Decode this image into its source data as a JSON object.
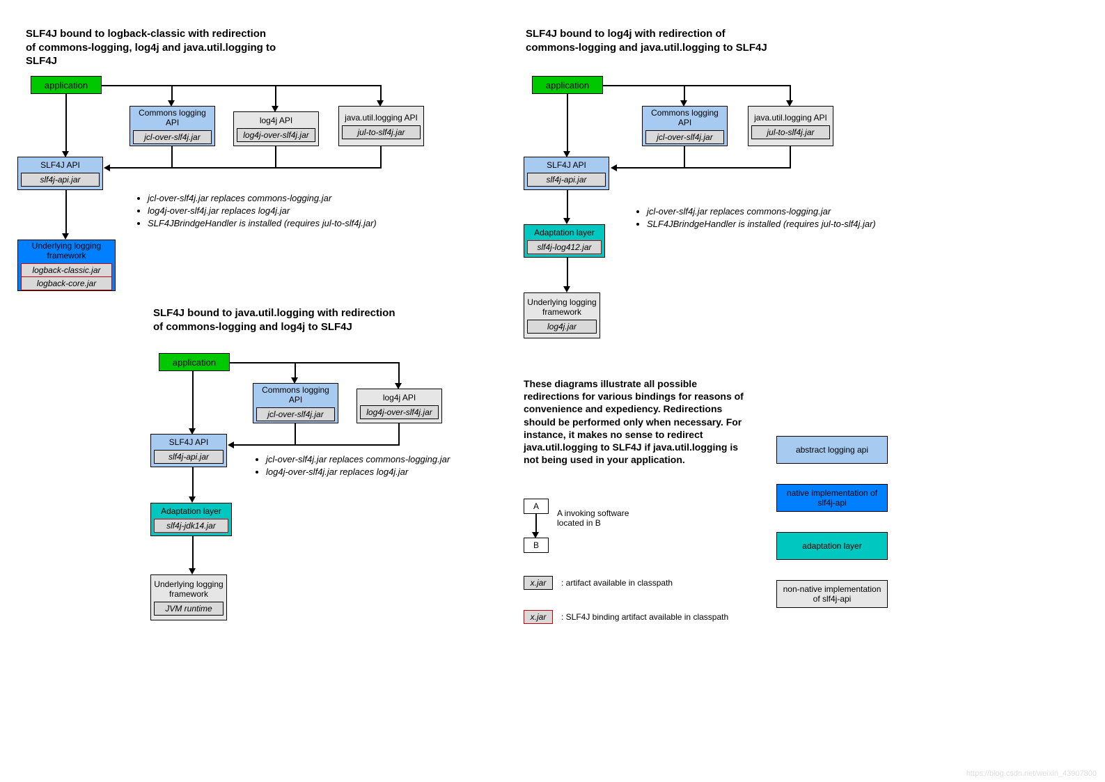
{
  "diagram1": {
    "title": "SLF4J bound to logback-classic with redirection of commons-logging, log4j and java.util.logging to SLF4J",
    "app": "application",
    "commons": "Commons logging API",
    "commons_jar": "jcl-over-slf4j.jar",
    "log4j": "log4j API",
    "log4j_jar": "log4j-over-slf4j.jar",
    "jul": "java.util.logging API",
    "jul_jar": "jul-to-slf4j.jar",
    "slf4j": "SLF4J API",
    "slf4j_jar": "slf4j-api.jar",
    "under": "Underlying logging framework",
    "under_jar1": "logback-classic.jar",
    "under_jar2": "logback-core.jar",
    "note1": "jcl-over-slf4j.jar replaces commons-logging.jar",
    "note2": "log4j-over-slf4j.jar replaces log4j.jar",
    "note3": "SLF4JBrindgeHandler is installed (requires jul-to-slf4j.jar)"
  },
  "diagram2": {
    "title": "SLF4J bound to java.util.logging with redirection of commons-logging and log4j to SLF4J",
    "app": "application",
    "commons": "Commons logging API",
    "commons_jar": "jcl-over-slf4j.jar",
    "log4j": "log4j API",
    "log4j_jar": "log4j-over-slf4j.jar",
    "slf4j": "SLF4J API",
    "slf4j_jar": "slf4j-api.jar",
    "adapt": "Adaptation layer",
    "adapt_jar": "slf4j-jdk14.jar",
    "under": "Underlying logging framework",
    "under_jar": "JVM runtime",
    "note1": "jcl-over-slf4j.jar replaces commons-logging.jar",
    "note2": "log4j-over-slf4j.jar replaces log4j.jar"
  },
  "diagram3": {
    "title": "SLF4J bound to log4j with redirection of commons-logging and java.util.logging to SLF4J",
    "app": "application",
    "commons": "Commons logging API",
    "commons_jar": "jcl-over-slf4j.jar",
    "jul": "java.util.logging API",
    "jul_jar": "jul-to-slf4j.jar",
    "slf4j": "SLF4J API",
    "slf4j_jar": "slf4j-api.jar",
    "adapt": "Adaptation layer",
    "adapt_jar": "slf4j-log412.jar",
    "under": "Underlying logging framework",
    "under_jar": "log4j.jar",
    "note1": "jcl-over-slf4j.jar replaces commons-logging.jar",
    "note2": "SLF4JBrindgeHandler is installed (requires jul-to-slf4j.jar)"
  },
  "summary": "These diagrams illustrate all possible redirections for various bindings for reasons of convenience and expediency. Redirections should be performed only when necessary. For instance, it makes no sense to redirect java.util.logging to SLF4J if java.util.logging is not being used in your application.",
  "legend": {
    "a": "A",
    "b": "B",
    "ab_text": "A invoking software located in B",
    "xjar": "x.jar",
    "xjar_text": ": artifact available in classpath",
    "xjar2": "x.jar",
    "xjar2_text": ": SLF4J binding artifact available in classpath",
    "abstract": "abstract logging api",
    "native": "native implementation of slf4j-api",
    "adapt": "adaptation layer",
    "nonnative": "non-native implementation of slf4j-api"
  },
  "watermark": "https://blog.csdn.net/weixin_43907800"
}
